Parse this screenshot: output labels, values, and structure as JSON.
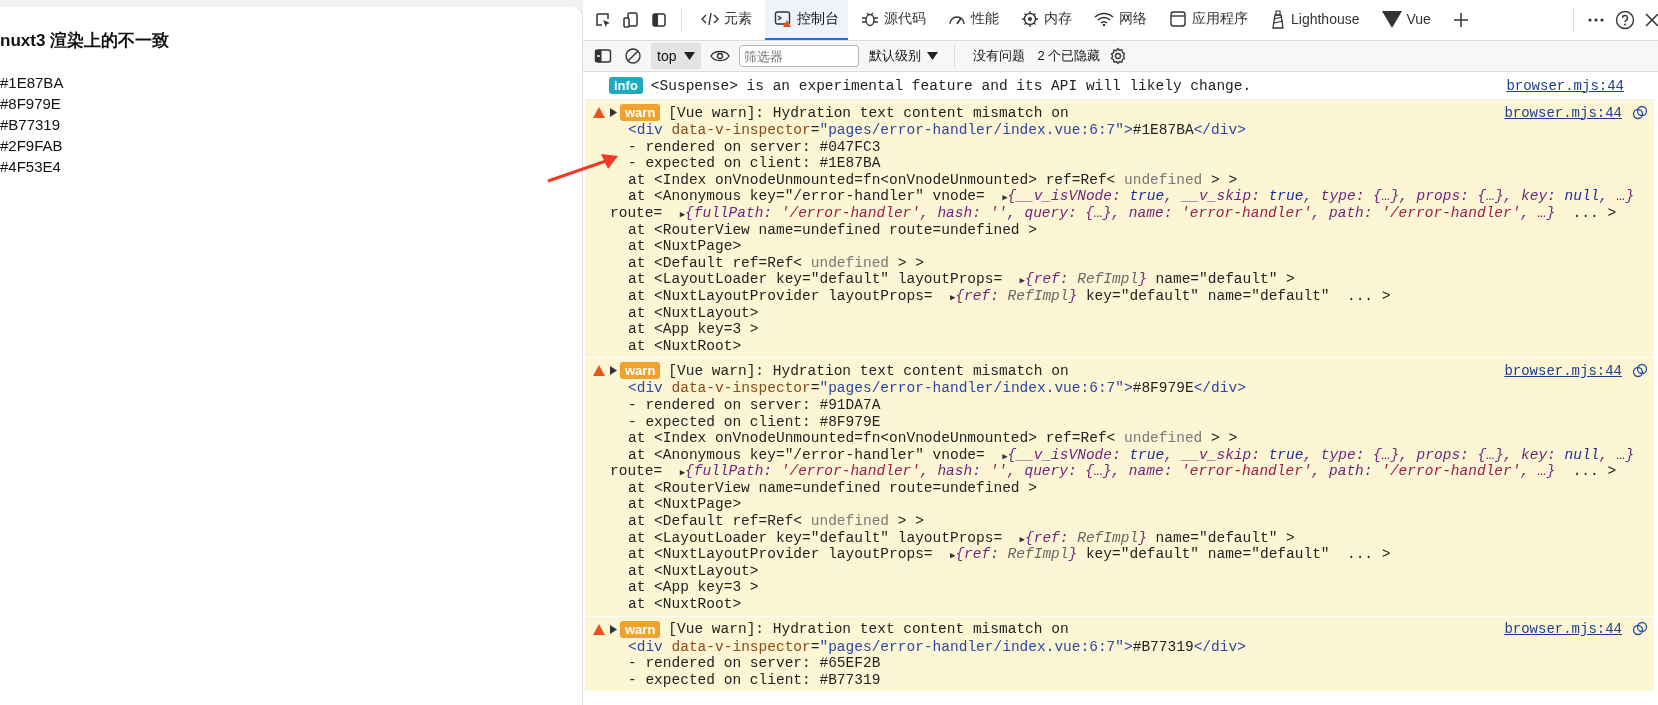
{
  "page": {
    "heading": "nuxt3 渲染上的不一致",
    "colors": [
      "#1E87BA",
      "#8F979E",
      "#B77319",
      "#2F9FAB",
      "#4F53E4"
    ]
  },
  "devtools": {
    "tabs": [
      {
        "label": "元素",
        "kind": "code",
        "selected": false
      },
      {
        "label": "控制台",
        "kind": "console",
        "selected": true
      },
      {
        "label": "源代码",
        "kind": "bug",
        "selected": false
      },
      {
        "label": "性能",
        "kind": "gauge",
        "selected": false
      },
      {
        "label": "内存",
        "kind": "chip",
        "selected": false
      },
      {
        "label": "网络",
        "kind": "wifi",
        "selected": false
      },
      {
        "label": "应用程序",
        "kind": "window",
        "selected": false
      },
      {
        "label": "Lighthouse",
        "kind": "lighthouse",
        "selected": false
      },
      {
        "label": "Vue",
        "kind": "vue",
        "selected": false
      }
    ],
    "toolbar": {
      "context": "top",
      "filter_placeholder": "筛选器",
      "levels": "默认级别",
      "issues": "没有问题",
      "hidden": "2 个已隐藏"
    },
    "messages": [
      {
        "kind": "info",
        "badge": "info",
        "text": "<Suspense> is an experimental feature and its API will likely change.",
        "source": "browser.mjs:44"
      },
      {
        "kind": "warn",
        "badge": "warn",
        "text": "[Vue warn]: Hydration text content mismatch on",
        "source": "browser.mjs:44",
        "lines": [
          {
            "kind": "line",
            "parts": [
              {
                "kind": "tag",
                "text": "<div "
              },
              {
                "kind": "attr",
                "text": "data-v-inspector"
              },
              {
                "kind": "plain",
                "text": "="
              },
              {
                "kind": "str",
                "text": "\"pages/error-handler/index.vue:6:7\""
              },
              {
                "kind": "tag",
                "text": ">"
              },
              {
                "kind": "plain",
                "text": "#1E87BA"
              },
              {
                "kind": "tag",
                "text": "</div>"
              }
            ]
          },
          {
            "kind": "line",
            "parts": [
              {
                "kind": "plain",
                "text": "- rendered on server: #047FC3"
              }
            ]
          },
          {
            "kind": "line",
            "parts": [
              {
                "kind": "plain",
                "text": "- expected on client: #1E87BA"
              }
            ]
          },
          {
            "kind": "line",
            "parts": [
              {
                "kind": "plain",
                "text": "at <Index onVnodeUnmounted=fn<onVnodeUnmounted> ref=Ref< "
              },
              {
                "kind": "muted",
                "text": "undefined"
              },
              {
                "kind": "plain",
                "text": " > >"
              }
            ]
          },
          {
            "kind": "line",
            "parts": [
              {
                "kind": "plain",
                "text": "at <Anonymous key=\"/error-handler\" vnode=  "
              },
              {
                "kind": "toggle",
                "text": "▶"
              },
              {
                "kind": "obj",
                "text": "{__v_isVNode: "
              },
              {
                "kind": "val",
                "text": "true"
              },
              {
                "kind": "obj",
                "text": ", __v_skip: "
              },
              {
                "kind": "val",
                "text": "true"
              },
              {
                "kind": "obj",
                "text": ", type: {…}, props: {…}, key: "
              },
              {
                "kind": "val",
                "text": "null"
              },
              {
                "kind": "obj",
                "text": ", …}"
              }
            ]
          },
          {
            "kind": "wrap",
            "parts": [
              {
                "kind": "plain",
                "text": "route=  "
              },
              {
                "kind": "toggle",
                "text": "▶"
              },
              {
                "kind": "obj",
                "text": "{fullPath: "
              },
              {
                "kind": "ostr",
                "text": "'/error-handler'"
              },
              {
                "kind": "obj",
                "text": ", hash: "
              },
              {
                "kind": "ostr",
                "text": "''"
              },
              {
                "kind": "obj",
                "text": ", query: {…}, name: "
              },
              {
                "kind": "ostr",
                "text": "'error-handler'"
              },
              {
                "kind": "obj",
                "text": ", path: "
              },
              {
                "kind": "ostr",
                "text": "'/error-handler'"
              },
              {
                "kind": "obj",
                "text": ", …}"
              },
              {
                "kind": "plain",
                "text": "  ... >"
              }
            ]
          },
          {
            "kind": "line",
            "parts": [
              {
                "kind": "plain",
                "text": "at <RouterView name=undefined route=undefined >"
              }
            ]
          },
          {
            "kind": "line",
            "parts": [
              {
                "kind": "plain",
                "text": "at <NuxtPage>"
              }
            ]
          },
          {
            "kind": "line",
            "parts": [
              {
                "kind": "plain",
                "text": "at <Default ref=Ref< "
              },
              {
                "kind": "muted",
                "text": "undefined"
              },
              {
                "kind": "plain",
                "text": " > >"
              }
            ]
          },
          {
            "kind": "line",
            "parts": [
              {
                "kind": "plain",
                "text": "at <LayoutLoader key=\"default\" layoutProps=  "
              },
              {
                "kind": "toggle",
                "text": "▶"
              },
              {
                "kind": "obj",
                "text": "{ref: "
              },
              {
                "kind": "otype",
                "text": "RefImpl"
              },
              {
                "kind": "obj",
                "text": "}"
              },
              {
                "kind": "plain",
                "text": " name=\"default\" >"
              }
            ]
          },
          {
            "kind": "line",
            "parts": [
              {
                "kind": "plain",
                "text": "at <NuxtLayoutProvider layoutProps=  "
              },
              {
                "kind": "toggle",
                "text": "▶"
              },
              {
                "kind": "obj",
                "text": "{ref: "
              },
              {
                "kind": "otype",
                "text": "RefImpl"
              },
              {
                "kind": "obj",
                "text": "}"
              },
              {
                "kind": "plain",
                "text": " key=\"default\" name=\"default\"  ... >"
              }
            ]
          },
          {
            "kind": "line",
            "parts": [
              {
                "kind": "plain",
                "text": "at <NuxtLayout>"
              }
            ]
          },
          {
            "kind": "line",
            "parts": [
              {
                "kind": "plain",
                "text": "at <App key=3 >"
              }
            ]
          },
          {
            "kind": "line",
            "parts": [
              {
                "kind": "plain",
                "text": "at <NuxtRoot>"
              }
            ]
          }
        ]
      },
      {
        "kind": "warn",
        "badge": "warn",
        "text": "[Vue warn]: Hydration text content mismatch on",
        "source": "browser.mjs:44",
        "lines": [
          {
            "kind": "line",
            "parts": [
              {
                "kind": "tag",
                "text": "<div "
              },
              {
                "kind": "attr",
                "text": "data-v-inspector"
              },
              {
                "kind": "plain",
                "text": "="
              },
              {
                "kind": "str",
                "text": "\"pages/error-handler/index.vue:6:7\""
              },
              {
                "kind": "tag",
                "text": ">"
              },
              {
                "kind": "plain",
                "text": "#8F979E"
              },
              {
                "kind": "tag",
                "text": "</div>"
              }
            ]
          },
          {
            "kind": "line",
            "parts": [
              {
                "kind": "plain",
                "text": "- rendered on server: #91DA7A"
              }
            ]
          },
          {
            "kind": "line",
            "parts": [
              {
                "kind": "plain",
                "text": "- expected on client: #8F979E"
              }
            ]
          },
          {
            "kind": "line",
            "parts": [
              {
                "kind": "plain",
                "text": "at <Index onVnodeUnmounted=fn<onVnodeUnmounted> ref=Ref< "
              },
              {
                "kind": "muted",
                "text": "undefined"
              },
              {
                "kind": "plain",
                "text": " > >"
              }
            ]
          },
          {
            "kind": "line",
            "parts": [
              {
                "kind": "plain",
                "text": "at <Anonymous key=\"/error-handler\" vnode=  "
              },
              {
                "kind": "toggle",
                "text": "▶"
              },
              {
                "kind": "obj",
                "text": "{__v_isVNode: "
              },
              {
                "kind": "val",
                "text": "true"
              },
              {
                "kind": "obj",
                "text": ", __v_skip: "
              },
              {
                "kind": "val",
                "text": "true"
              },
              {
                "kind": "obj",
                "text": ", type: {…}, props: {…}, key: "
              },
              {
                "kind": "val",
                "text": "null"
              },
              {
                "kind": "obj",
                "text": ", …}"
              }
            ]
          },
          {
            "kind": "wrap",
            "parts": [
              {
                "kind": "plain",
                "text": "route=  "
              },
              {
                "kind": "toggle",
                "text": "▶"
              },
              {
                "kind": "obj",
                "text": "{fullPath: "
              },
              {
                "kind": "ostr",
                "text": "'/error-handler'"
              },
              {
                "kind": "obj",
                "text": ", hash: "
              },
              {
                "kind": "ostr",
                "text": "''"
              },
              {
                "kind": "obj",
                "text": ", query: {…}, name: "
              },
              {
                "kind": "ostr",
                "text": "'error-handler'"
              },
              {
                "kind": "obj",
                "text": ", path: "
              },
              {
                "kind": "ostr",
                "text": "'/error-handler'"
              },
              {
                "kind": "obj",
                "text": ", …}"
              },
              {
                "kind": "plain",
                "text": "  ... >"
              }
            ]
          },
          {
            "kind": "line",
            "parts": [
              {
                "kind": "plain",
                "text": "at <RouterView name=undefined route=undefined >"
              }
            ]
          },
          {
            "kind": "line",
            "parts": [
              {
                "kind": "plain",
                "text": "at <NuxtPage>"
              }
            ]
          },
          {
            "kind": "line",
            "parts": [
              {
                "kind": "plain",
                "text": "at <Default ref=Ref< "
              },
              {
                "kind": "muted",
                "text": "undefined"
              },
              {
                "kind": "plain",
                "text": " > >"
              }
            ]
          },
          {
            "kind": "line",
            "parts": [
              {
                "kind": "plain",
                "text": "at <LayoutLoader key=\"default\" layoutProps=  "
              },
              {
                "kind": "toggle",
                "text": "▶"
              },
              {
                "kind": "obj",
                "text": "{ref: "
              },
              {
                "kind": "otype",
                "text": "RefImpl"
              },
              {
                "kind": "obj",
                "text": "}"
              },
              {
                "kind": "plain",
                "text": " name=\"default\" >"
              }
            ]
          },
          {
            "kind": "line",
            "parts": [
              {
                "kind": "plain",
                "text": "at <NuxtLayoutProvider layoutProps=  "
              },
              {
                "kind": "toggle",
                "text": "▶"
              },
              {
                "kind": "obj",
                "text": "{ref: "
              },
              {
                "kind": "otype",
                "text": "RefImpl"
              },
              {
                "kind": "obj",
                "text": "}"
              },
              {
                "kind": "plain",
                "text": " key=\"default\" name=\"default\"  ... >"
              }
            ]
          },
          {
            "kind": "line",
            "parts": [
              {
                "kind": "plain",
                "text": "at <NuxtLayout>"
              }
            ]
          },
          {
            "kind": "line",
            "parts": [
              {
                "kind": "plain",
                "text": "at <App key=3 >"
              }
            ]
          },
          {
            "kind": "line",
            "parts": [
              {
                "kind": "plain",
                "text": "at <NuxtRoot>"
              }
            ]
          }
        ]
      },
      {
        "kind": "warn",
        "badge": "warn",
        "text": "[Vue warn]: Hydration text content mismatch on",
        "source": "browser.mjs:44",
        "lines": [
          {
            "kind": "line",
            "parts": [
              {
                "kind": "tag",
                "text": "<div "
              },
              {
                "kind": "attr",
                "text": "data-v-inspector"
              },
              {
                "kind": "plain",
                "text": "="
              },
              {
                "kind": "str",
                "text": "\"pages/error-handler/index.vue:6:7\""
              },
              {
                "kind": "tag",
                "text": ">"
              },
              {
                "kind": "plain",
                "text": "#B77319"
              },
              {
                "kind": "tag",
                "text": "</div>"
              }
            ]
          },
          {
            "kind": "line",
            "parts": [
              {
                "kind": "plain",
                "text": "- rendered on server: #65EF2B"
              }
            ]
          },
          {
            "kind": "line",
            "parts": [
              {
                "kind": "plain",
                "text": "- expected on client: #B77319"
              }
            ]
          }
        ]
      }
    ]
  }
}
